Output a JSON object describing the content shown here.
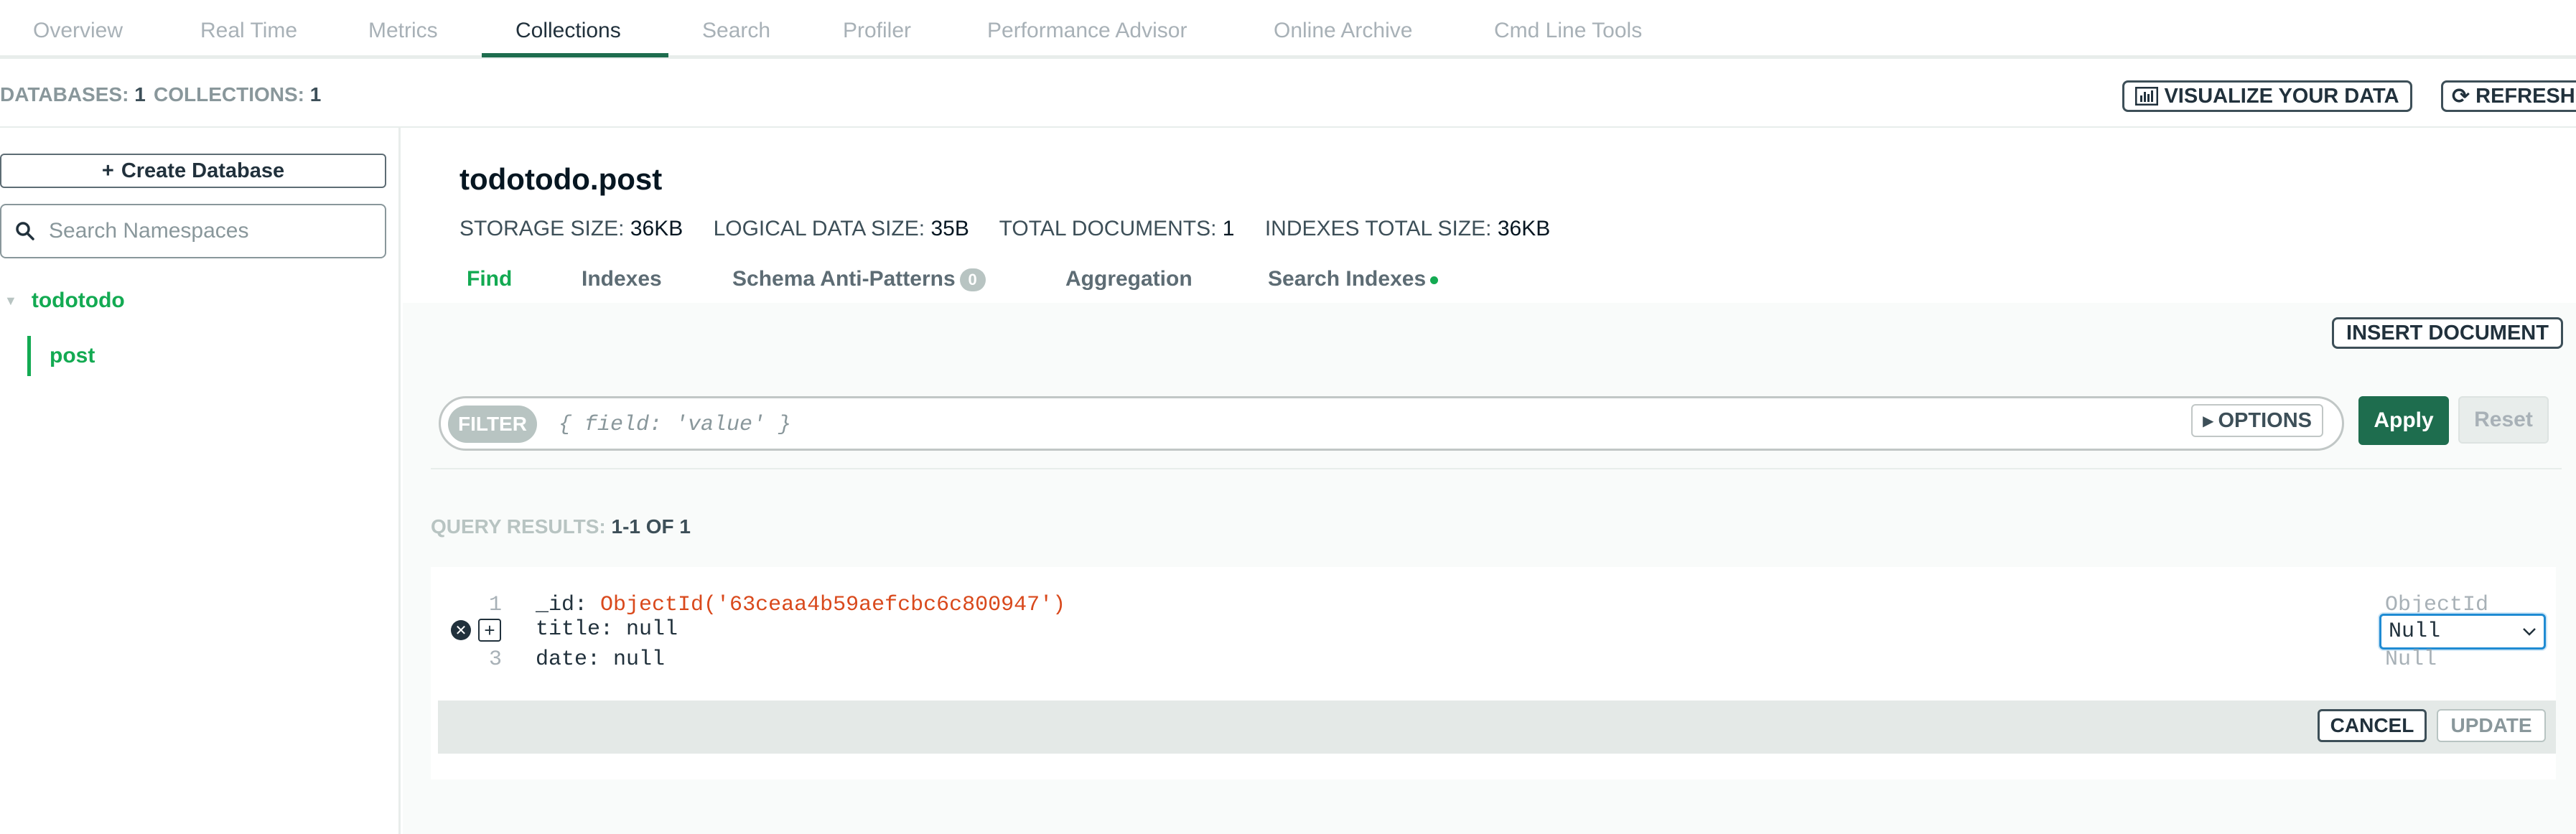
{
  "topnav": {
    "tabs": [
      {
        "label": "Overview"
      },
      {
        "label": "Real Time"
      },
      {
        "label": "Metrics"
      },
      {
        "label": "Collections"
      },
      {
        "label": "Search"
      },
      {
        "label": "Profiler"
      },
      {
        "label": "Performance Advisor"
      },
      {
        "label": "Online Archive"
      },
      {
        "label": "Cmd Line Tools"
      }
    ],
    "active_tab": "Collections"
  },
  "stats": {
    "databases_label": "DATABASES:",
    "databases_value": "1",
    "collections_label": "COLLECTIONS:",
    "collections_value": "1"
  },
  "toolbar": {
    "visualize_label": "VISUALIZE YOUR DATA",
    "refresh_label": "REFRESH"
  },
  "sidebar": {
    "create_db_label": "Create Database",
    "search_placeholder": "Search Namespaces",
    "databases": [
      {
        "name": "todotodo",
        "collections": [
          {
            "name": "post"
          }
        ]
      }
    ]
  },
  "collection": {
    "title": "todotodo.post",
    "storage_size_label": "STORAGE SIZE:",
    "storage_size_value": "36KB",
    "logical_size_label": "LOGICAL DATA SIZE:",
    "logical_size_value": "35B",
    "total_docs_label": "TOTAL DOCUMENTS:",
    "total_docs_value": "1",
    "indexes_size_label": "INDEXES TOTAL SIZE:",
    "indexes_size_value": "36KB"
  },
  "subtabs": {
    "find": "Find",
    "indexes": "Indexes",
    "schema": "Schema Anti-Patterns",
    "schema_badge": "0",
    "aggregation": "Aggregation",
    "search_indexes": "Search Indexes"
  },
  "query": {
    "insert_label": "INSERT DOCUMENT",
    "filter_pill": "FILTER",
    "filter_placeholder": "{ field: 'value' }",
    "options_label": "OPTIONS",
    "apply_label": "Apply",
    "reset_label": "Reset",
    "results_label": "QUERY RESULTS:",
    "results_value": "1-1 OF 1"
  },
  "document": {
    "lines": [
      {
        "no": "1",
        "key": "_id:",
        "value": "ObjectId('63ceaa4b59aefcbc6c800947')",
        "type": "ObjectId"
      },
      {
        "no": "",
        "key": "title:",
        "value": "null",
        "type": "Null"
      },
      {
        "no": "3",
        "key": "date:",
        "value": "null",
        "type": "Null"
      }
    ],
    "cancel_label": "CANCEL",
    "update_label": "UPDATE"
  },
  "colors": {
    "accent_green": "#13aa52",
    "dark_green": "#1e6d4e",
    "objectid_orange": "#d9491c",
    "focus_blue": "#1f8bd3"
  }
}
